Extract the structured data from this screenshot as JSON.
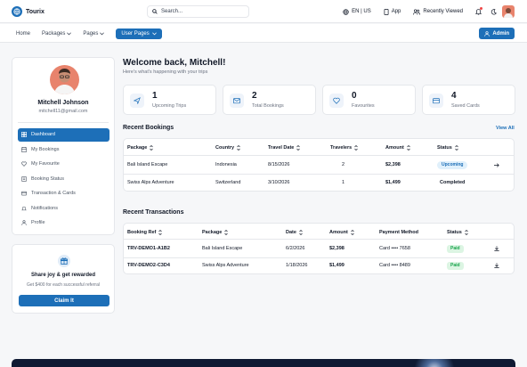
{
  "brand": {
    "name": "Tourix"
  },
  "search": {
    "placeholder": "Search..."
  },
  "topbar": {
    "language": "EN | US",
    "app_label": "App",
    "recently_viewed": "Recently Viewed"
  },
  "nav": {
    "home": "Home",
    "packages": "Packages",
    "pages": "Pages",
    "user_pages": "User Pages",
    "admin": "Admin"
  },
  "profile": {
    "name": "Mitchell Johnson",
    "email": "mitchell11@gmail.com",
    "menu": [
      {
        "label": "Dashboard",
        "icon": "dashboard-icon",
        "active": true
      },
      {
        "label": "My Bookings",
        "icon": "bookings-icon"
      },
      {
        "label": "My Favourite",
        "icon": "heart-icon"
      },
      {
        "label": "Booking Status",
        "icon": "status-icon"
      },
      {
        "label": "Transaction & Cards",
        "icon": "card-icon"
      },
      {
        "label": "Notifications",
        "icon": "bell-icon"
      },
      {
        "label": "Profile",
        "icon": "user-icon"
      }
    ]
  },
  "promo": {
    "title": "Share joy & get rewarded",
    "subtitle": "Get $400 for each successful referral",
    "button": "Claim It"
  },
  "welcome": {
    "title": "Welcome back, Mitchell!",
    "subtitle": "Here's what's happening with your trips"
  },
  "stats": [
    {
      "value": "1",
      "label": "Upcoming Trips",
      "icon": "plane-icon"
    },
    {
      "value": "2",
      "label": "Total Bookings",
      "icon": "mail-icon"
    },
    {
      "value": "0",
      "label": "Favourites",
      "icon": "heart-icon"
    },
    {
      "value": "4",
      "label": "Saved Cards",
      "icon": "card-icon"
    }
  ],
  "recent_bookings": {
    "title": "Recent Bookings",
    "view_all": "View All",
    "headers": [
      "Package",
      "Country",
      "Travel Date",
      "Travelers",
      "Amount",
      "Status"
    ],
    "rows": [
      {
        "package": "Bali Island Escape",
        "country": "Indonesia",
        "date": "8/15/2026",
        "travelers": "2",
        "amount": "$2,398",
        "status": "Upcoming"
      },
      {
        "package": "Swiss Alps Adventure",
        "country": "Switzerland",
        "date": "3/10/2026",
        "travelers": "1",
        "amount": "$1,499",
        "status": "Completed"
      }
    ]
  },
  "recent_transactions": {
    "title": "Recent Transactions",
    "headers": [
      "Booking Ref",
      "Package",
      "Date",
      "Amount",
      "Payment Method",
      "Status"
    ],
    "rows": [
      {
        "ref": "TRV-DEMO1-A1B2",
        "package": "Bali Island Escape",
        "date": "6/2/2026",
        "amount": "$2,398",
        "method": "Card •••• 7658",
        "status": "Paid"
      },
      {
        "ref": "TRV-DEMO2-C3D4",
        "package": "Swiss Alps Adventure",
        "date": "1/18/2026",
        "amount": "$1,499",
        "method": "Card •••• 8489",
        "status": "Paid"
      }
    ]
  },
  "colors": {
    "accent": "#1d6fb8",
    "paid": "#16a34a",
    "avatar_bg": "#e8836c"
  }
}
